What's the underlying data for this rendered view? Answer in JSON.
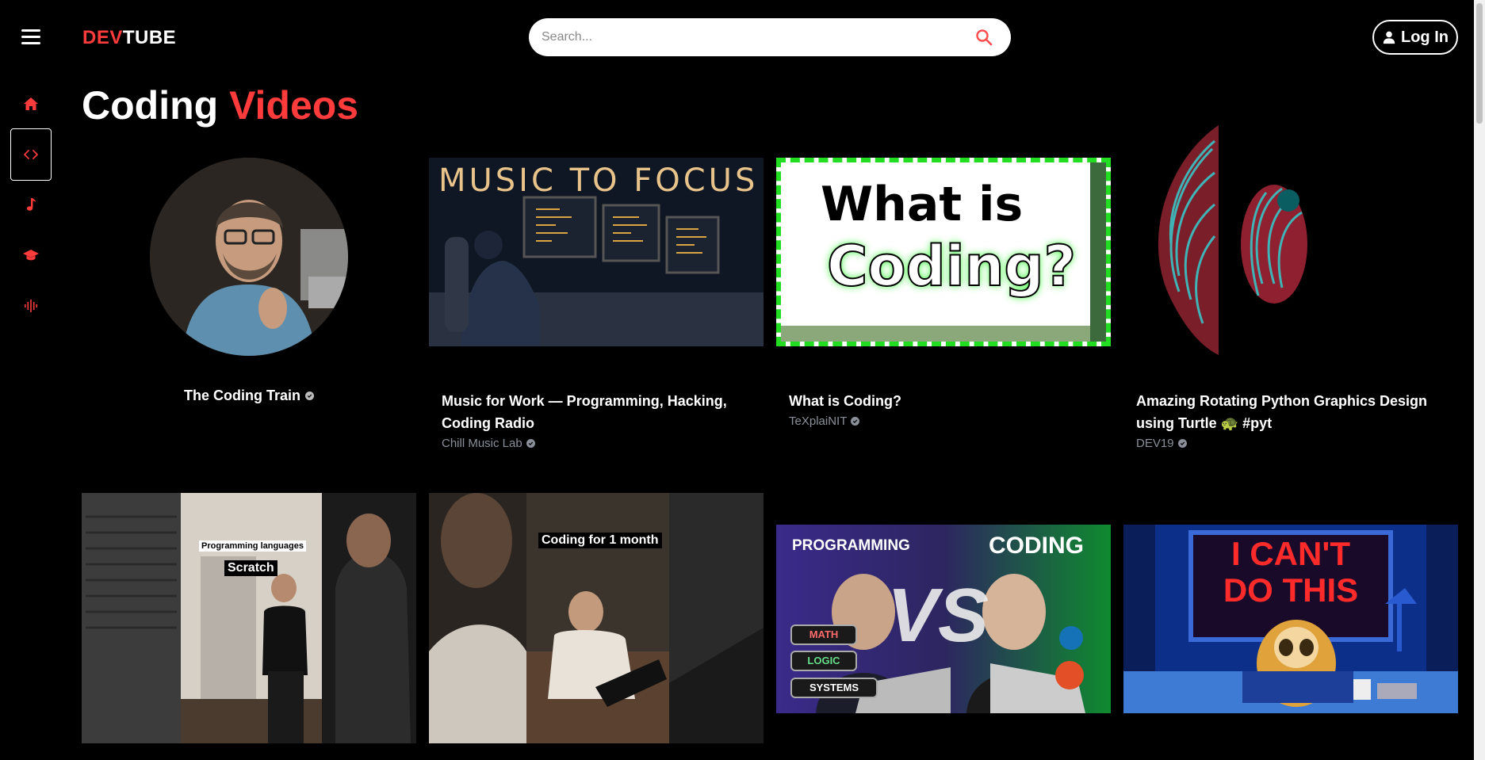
{
  "header": {
    "logo_dev": "DEV",
    "logo_tube": "TUBE",
    "search_placeholder": "Search...",
    "login_label": "Log In"
  },
  "sidebar": {
    "items": [
      {
        "name": "home",
        "icon": "home-icon"
      },
      {
        "name": "coding",
        "icon": "code-icon",
        "active": true
      },
      {
        "name": "music",
        "icon": "music-note-icon"
      },
      {
        "name": "education",
        "icon": "graduation-cap-icon"
      },
      {
        "name": "podcast",
        "icon": "audio-wave-icon"
      }
    ]
  },
  "page": {
    "title_part1": "Coding",
    "title_part2": "Videos"
  },
  "colors": {
    "accent": "#ff3b3b",
    "background": "#000000",
    "muted": "#8a8f99"
  },
  "cards": [
    {
      "type": "channel",
      "channel": "The Coding Train",
      "verified": true
    },
    {
      "type": "video",
      "title": "Music for Work — Programming, Hacking, Coding Radio",
      "channel": "Chill Music Lab",
      "verified": true,
      "thumb_text": "MUSIC TO FOCUS"
    },
    {
      "type": "video",
      "title": "What is Coding?",
      "channel": "TeXplaiNIT",
      "verified": true,
      "thumb_text1": "What is",
      "thumb_text2": "Coding?"
    },
    {
      "type": "video",
      "title": "Amazing Rotating Python Graphics Design using Turtle 🐢 #pyt",
      "channel": "DEV19",
      "verified": true
    },
    {
      "type": "short",
      "thumb_text1": "Programming languages",
      "thumb_text2": "Scratch"
    },
    {
      "type": "short",
      "thumb_text": "Coding for 1 month"
    },
    {
      "type": "video",
      "thumb_left": "PROGRAMMING",
      "thumb_right": "CODING",
      "thumb_vs": "VS",
      "tags": [
        "MATH",
        "LOGIC",
        "SYSTEMS"
      ]
    },
    {
      "type": "video",
      "thumb_text1": "I CAN'T",
      "thumb_text2": "DO THIS"
    }
  ]
}
